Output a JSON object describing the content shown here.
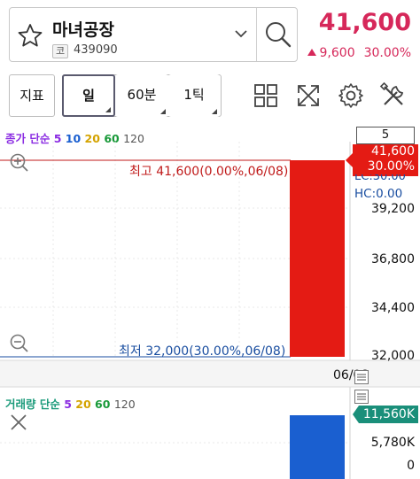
{
  "header": {
    "stock_name": "마녀공장",
    "code_badge": "코",
    "stock_code": "439090",
    "price": "41,600",
    "change": "9,600",
    "change_pct": "30.00%"
  },
  "toolbar": {
    "indicator_label": "지표",
    "periods": [
      "일",
      "60분",
      "1틱"
    ],
    "active_period": "일"
  },
  "chart": {
    "ma_title": "종가 단순",
    "ma_periods": [
      "5",
      "10",
      "20",
      "60",
      "120"
    ],
    "ma_colors": [
      "#8a2be2",
      "#1a5fd0",
      "#d4a300",
      "#1a9a3a",
      "#555555"
    ],
    "period_value": "5",
    "price_tag": [
      "41,600",
      "30.00%"
    ],
    "lc_label": "LC:30.00",
    "hc_label": "HC:0.00",
    "high_label": "최고 41,600(0.00%,06/08)",
    "low_label": "최저 32,000(30.00%,06/08)",
    "y_ticks": [
      "39,200",
      "36,800",
      "34,400",
      "32,000"
    ],
    "date": "06/08",
    "colors": {
      "up": "#e41b14",
      "high_line": "#c01a1a",
      "low_line": "#1a4ea0"
    }
  },
  "volume": {
    "title": "거래량 단순",
    "ma_periods": [
      "5",
      "20",
      "60",
      "120"
    ],
    "ma_colors": [
      "#8a2be2",
      "#d4a300",
      "#1a9a3a",
      "#555555"
    ],
    "tag": "11,560K",
    "y_ticks": [
      "5,780K",
      "0"
    ],
    "bar_color": "#1a5fd0"
  },
  "chart_data": {
    "type": "bar",
    "categories": [
      "06/08"
    ],
    "series": [
      {
        "open": 32000,
        "high": 41600,
        "low": 32000,
        "close": 41600
      }
    ],
    "volume": [
      11560
    ],
    "ylim": [
      32000,
      41600
    ],
    "volume_ylim": [
      0,
      11560
    ]
  }
}
